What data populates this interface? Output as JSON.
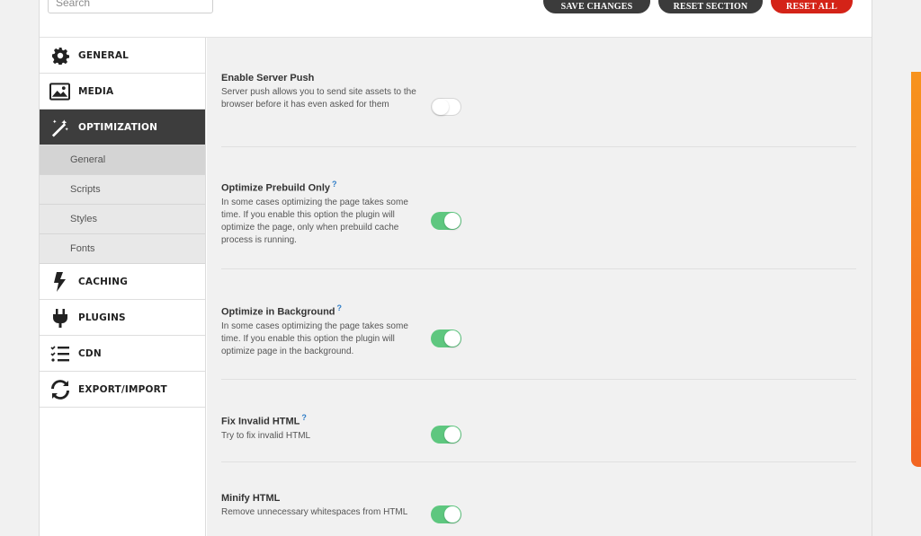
{
  "search": {
    "placeholder": "Search"
  },
  "toolbar": {
    "save_label": "SAVE CHANGES",
    "reset_section_label": "RESET SECTION",
    "reset_all_label": "RESET ALL"
  },
  "sidebar": {
    "items": [
      {
        "label": "GENERAL",
        "icon": "gear-icon"
      },
      {
        "label": "MEDIA",
        "icon": "image-icon"
      },
      {
        "label": "OPTIMIZATION",
        "icon": "magic-wand-icon"
      },
      {
        "label": "CACHING",
        "icon": "lightning-icon"
      },
      {
        "label": "PLUGINS",
        "icon": "plug-icon"
      },
      {
        "label": "CDN",
        "icon": "checklist-icon"
      },
      {
        "label": "EXPORT/IMPORT",
        "icon": "sync-icon"
      }
    ],
    "sub_items": [
      "General",
      "Scripts",
      "Styles",
      "Fonts"
    ]
  },
  "options": [
    {
      "title": "Enable Server Push",
      "help": "",
      "desc": "Server push allows you to send site assets to the browser before it has even asked for them",
      "enabled": false
    },
    {
      "title": "Optimize Prebuild Only",
      "help": "?",
      "desc": "In some cases optimizing the page takes some time. If you enable this option the plugin will optimize the page, only when prebuild cache process is running.",
      "enabled": true
    },
    {
      "title": "Optimize in Background",
      "help": "?",
      "desc": "In some cases optimizing the page takes some time. If you enable this option the plugin will optimize page in the background.",
      "enabled": true
    },
    {
      "title": "Fix Invalid HTML",
      "help": "?",
      "desc": "Try to fix invalid HTML",
      "enabled": true
    },
    {
      "title": "Minify HTML",
      "help": "",
      "desc": "Remove unnecessary whitespaces from HTML",
      "enabled": true
    }
  ],
  "colors": {
    "toggle_on": "#5ec77f",
    "active_nav": "#3d3d3d",
    "danger": "#d42318",
    "help_mark": "#2f7dc7"
  }
}
